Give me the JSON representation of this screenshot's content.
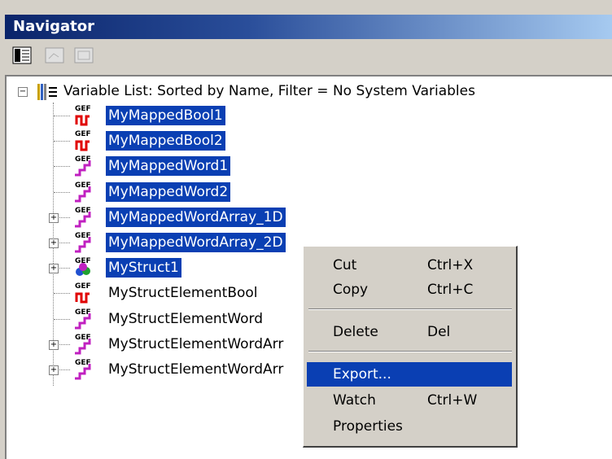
{
  "window": {
    "title": "Navigator"
  },
  "toolbar": {
    "buttons": [
      "tree-view-icon",
      "disabled-icon-1",
      "disabled-icon-2"
    ]
  },
  "tree": {
    "root_label": "Variable List: Sorted by Name, Filter = No System Variables",
    "items": [
      {
        "label": "MyMappedBool1",
        "icon": "bool-gef-icon",
        "expandable": false,
        "selected": true
      },
      {
        "label": "MyMappedBool2",
        "icon": "bool-gef-icon",
        "expandable": false,
        "selected": true
      },
      {
        "label": "MyMappedWord1",
        "icon": "word-gef-icon",
        "expandable": false,
        "selected": true
      },
      {
        "label": "MyMappedWord2",
        "icon": "word-gef-icon",
        "expandable": false,
        "selected": true
      },
      {
        "label": "MyMappedWordArray_1D",
        "icon": "word-gef-icon",
        "expandable": true,
        "selected": true
      },
      {
        "label": "MyMappedWordArray_2D",
        "icon": "word-gef-icon",
        "expandable": true,
        "selected": true
      },
      {
        "label": "MyStruct1",
        "icon": "struct-gef-icon",
        "expandable": true,
        "selected": true,
        "focused": true
      },
      {
        "label": "MyStructElementBool",
        "icon": "bool-gef-icon",
        "expandable": false,
        "selected": false
      },
      {
        "label": "MyStructElementWord",
        "icon": "word-gef-icon",
        "expandable": false,
        "selected": false
      },
      {
        "label": "MyStructElementWordArr",
        "icon": "word-gef-icon",
        "expandable": true,
        "selected": false
      },
      {
        "label": "MyStructElementWordArr",
        "icon": "word-gef-icon",
        "expandable": true,
        "selected": false
      }
    ],
    "gef_text": "GEF"
  },
  "context_menu": {
    "items": [
      {
        "label": "Cut",
        "shortcut": "Ctrl+X"
      },
      {
        "label": "Copy",
        "shortcut": "Ctrl+C"
      },
      {
        "label": "Delete",
        "shortcut": "Del"
      },
      {
        "label": "Export...",
        "shortcut": "",
        "highlighted": true
      },
      {
        "label": "Watch",
        "shortcut": "Ctrl+W"
      },
      {
        "label": "Properties",
        "shortcut": ""
      }
    ]
  },
  "colors": {
    "selection": "#0a3fb3",
    "title_start": "#0a246a",
    "panel": "#d4d0c8"
  }
}
